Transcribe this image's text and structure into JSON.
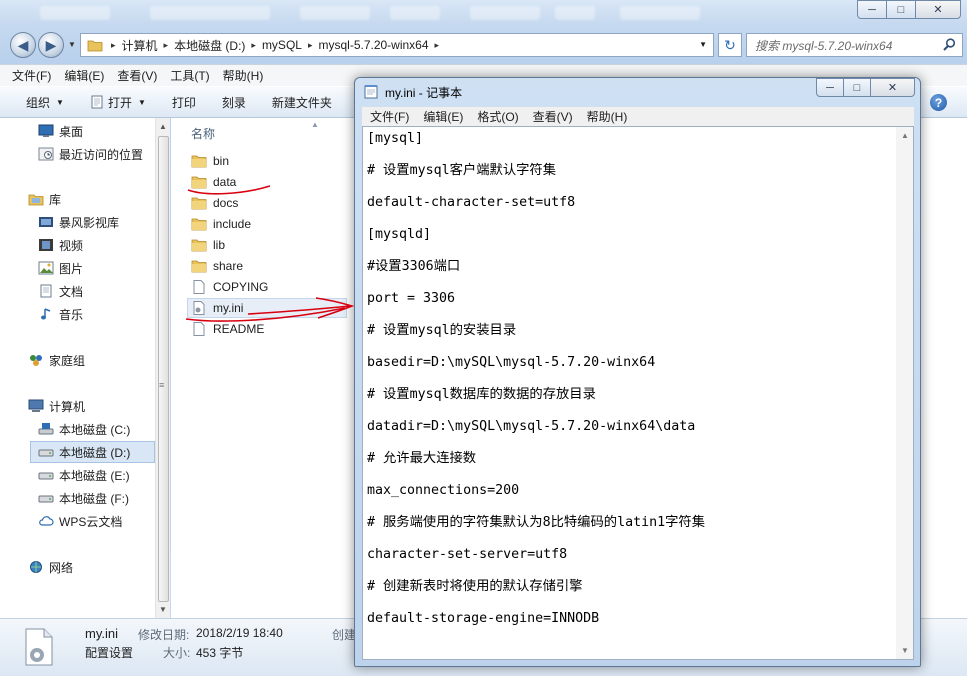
{
  "explorer": {
    "window_buttons": {
      "minimize": "─",
      "maximize": "□",
      "close": "✕"
    },
    "breadcrumbs": [
      "计算机",
      "本地磁盘 (D:)",
      "mySQL",
      "mysql-5.7.20-winx64"
    ],
    "search_placeholder": "搜索 mysql-5.7.20-winx64",
    "menu": [
      "文件(F)",
      "编辑(E)",
      "查看(V)",
      "工具(T)",
      "帮助(H)"
    ],
    "toolbar": {
      "organize": "组织",
      "open": "打开",
      "print": "打印",
      "burn": "刻录",
      "new_folder": "新建文件夹"
    },
    "nav": {
      "desktop": "桌面",
      "recent": "最近访问的位置",
      "libraries": "库",
      "storm_video": "暴风影视库",
      "videos": "视频",
      "pictures": "图片",
      "documents": "文档",
      "music": "音乐",
      "homegroup": "家庭组",
      "computer": "计算机",
      "drive_c": "本地磁盘 (C:)",
      "drive_d": "本地磁盘 (D:)",
      "drive_e": "本地磁盘 (E:)",
      "drive_f": "本地磁盘 (F:)",
      "wps_cloud": "WPS云文档",
      "network": "网络"
    },
    "column_name": "名称",
    "files": [
      {
        "name": "bin",
        "type": "folder"
      },
      {
        "name": "data",
        "type": "folder"
      },
      {
        "name": "docs",
        "type": "folder"
      },
      {
        "name": "include",
        "type": "folder"
      },
      {
        "name": "lib",
        "type": "folder"
      },
      {
        "name": "share",
        "type": "folder"
      },
      {
        "name": "COPYING",
        "type": "file"
      },
      {
        "name": "my.ini",
        "type": "ini"
      },
      {
        "name": "README",
        "type": "file"
      }
    ],
    "details": {
      "filename": "my.ini",
      "filetype": "配置设置",
      "modified_label": "修改日期:",
      "modified_value": "2018/2/19 18:40",
      "size_label": "大小:",
      "size_value": "453 字节",
      "created_label": "创建"
    }
  },
  "notepad": {
    "title": "my.ini - 记事本",
    "window_buttons": {
      "minimize": "─",
      "maximize": "□",
      "close": "✕"
    },
    "menu": [
      "文件(F)",
      "编辑(E)",
      "格式(O)",
      "查看(V)",
      "帮助(H)"
    ],
    "lines": [
      "[mysql]",
      "# 设置mysql客户端默认字符集",
      "default-character-set=utf8",
      "[mysqld]",
      "#设置3306端口",
      "port = 3306",
      "# 设置mysql的安装目录",
      "basedir=D:\\mySQL\\mysql-5.7.20-winx64",
      "# 设置mysql数据库的数据的存放目录",
      "datadir=D:\\mySQL\\mysql-5.7.20-winx64\\data",
      "# 允许最大连接数",
      "max_connections=200",
      "# 服务端使用的字符集默认为8比特编码的latin1字符集",
      "character-set-server=utf8",
      "# 创建新表时将使用的默认存储引擎",
      "default-storage-engine=INNODB"
    ]
  },
  "colors": {
    "annotation_red": "#d8000f",
    "folder_yellow": "#e8c25a",
    "selection_blue": "#d9e6f5"
  }
}
